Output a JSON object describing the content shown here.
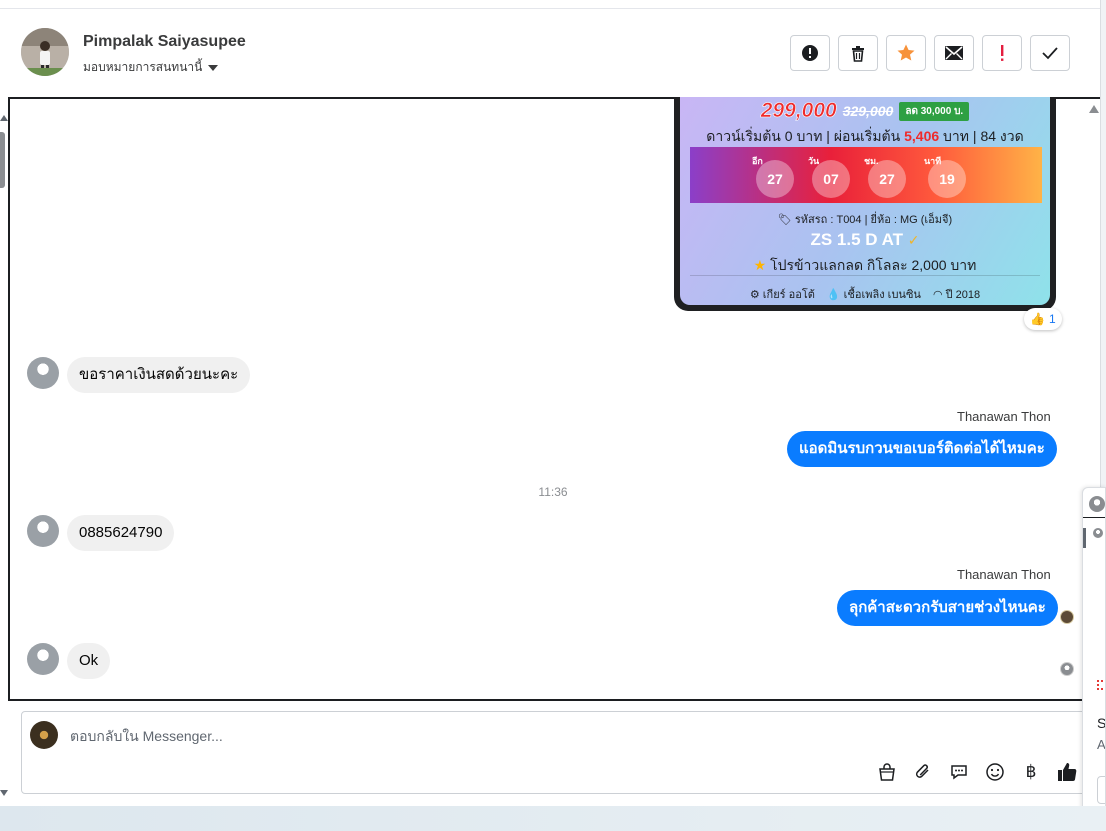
{
  "header": {
    "contact_name": "Pimpalak Saiyasupee",
    "assign_label": "มอบหมายการสนทนานี้",
    "toolbar": [
      {
        "name": "spam-button",
        "icon": "alert-circle-icon"
      },
      {
        "name": "delete-button",
        "icon": "trash-icon"
      },
      {
        "name": "star-button",
        "icon": "star-icon"
      },
      {
        "name": "mark-unread-button",
        "icon": "envelope-icon"
      },
      {
        "name": "follow-up-button",
        "icon": "exclamation-icon"
      },
      {
        "name": "done-button",
        "icon": "check-icon"
      }
    ]
  },
  "card": {
    "price_new": "299,000",
    "price_old": "329,000",
    "discount": "ลด 30,000 บ.",
    "finance_prefix": "ดาวน์เริ่มต้น 0 บาท | ผ่อนเริ่มต้น",
    "finance_amount": "5,406",
    "finance_suffix": "บาท | 84 งวด",
    "countdown": [
      {
        "label": "อีก",
        "value": "27"
      },
      {
        "label": "วัน",
        "value": "07"
      },
      {
        "label": "ชม.",
        "value": "27"
      },
      {
        "label": "นาที",
        "value": "19"
      }
    ],
    "car_code": "รหัสรถ : T004 | ยี่ห้อ : MG (เอ็มจี)",
    "car_model": "ZS 1.5 D AT",
    "promo": "โปรข้าวแลกลด กิโลละ 2,000 บาท",
    "specs": [
      "เกียร์ ออโต้",
      "เชื้อเพลิง เบนซิน",
      "ปี 2018"
    ]
  },
  "reaction": {
    "emoji": "👍",
    "count": "1"
  },
  "messages": {
    "m1": "ขอราคาเงินสดด้วยนะคะ",
    "sender1": "Thanawan Thon",
    "m2": "แอดมินรบกวนขอเบอร์ติดต่อได้ไหมคะ",
    "time": "11:36",
    "m3": "0885624790",
    "sender2": "Thanawan Thon",
    "m4": "ลุกค้าสะดวกรับสายช่วงไหนคะ",
    "m5": "Ok"
  },
  "composer": {
    "placeholder": "ตอบกลับใน Messenger...",
    "tools": [
      "shopping-bag-icon",
      "paperclip-icon",
      "saved-replies-icon",
      "emoji-icon",
      "baht-icon",
      "thumbs-up-icon"
    ]
  },
  "side_panel": {
    "text1": "S",
    "text2": "A"
  },
  "colors": {
    "accent": "#0a7cff",
    "price": "#ef2b2b",
    "star": "#f7923a"
  }
}
